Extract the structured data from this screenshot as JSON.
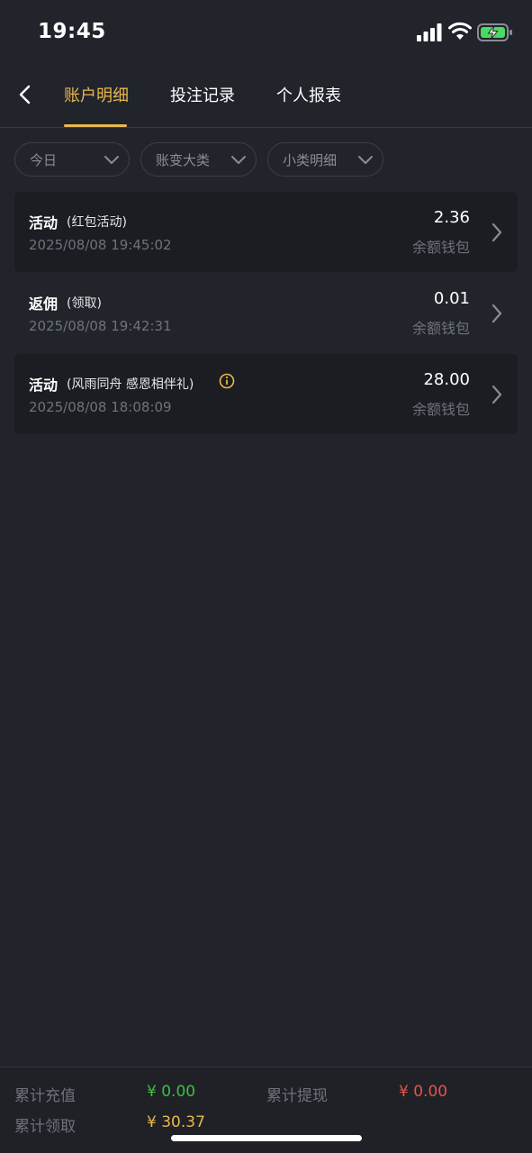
{
  "status_bar": {
    "time": "19:45"
  },
  "nav": {
    "tabs": [
      {
        "label": "账户明细",
        "active": true
      },
      {
        "label": "投注记录",
        "active": false
      },
      {
        "label": "个人报表",
        "active": false
      }
    ]
  },
  "filters": [
    {
      "label": "今日"
    },
    {
      "label": "账变大类"
    },
    {
      "label": "小类明细"
    }
  ],
  "records": [
    {
      "type": "活动",
      "detail": "(红包活动)",
      "time": "2025/08/08 19:45:02",
      "amount": "2.36",
      "wallet": "余额钱包",
      "has_info": false
    },
    {
      "type": "返佣",
      "detail": "(领取)",
      "time": "2025/08/08 19:42:31",
      "amount": "0.01",
      "wallet": "余额钱包",
      "has_info": false
    },
    {
      "type": "活动",
      "detail": "(风雨同舟 感恩相伴礼)",
      "time": "2025/08/08 18:08:09",
      "amount": "28.00",
      "wallet": "余额钱包",
      "has_info": true
    }
  ],
  "summary": {
    "recharge_label": "累计充值",
    "recharge_value": "¥ 0.00",
    "withdraw_label": "累计提现",
    "withdraw_value": "¥ 0.00",
    "claim_label": "累计领取",
    "claim_value": "¥ 30.37"
  },
  "colors": {
    "background": "#22242c",
    "accent": "#e9b84a",
    "positive": "#3fbf3f",
    "negative": "#e5544b",
    "muted": "#6f727b",
    "info_icon": "#e9b84a"
  },
  "icons": [
    "signal-icon",
    "wifi-icon",
    "battery-charging-icon",
    "back-chevron-icon",
    "chevron-down-icon",
    "chevron-right-icon",
    "info-icon"
  ]
}
